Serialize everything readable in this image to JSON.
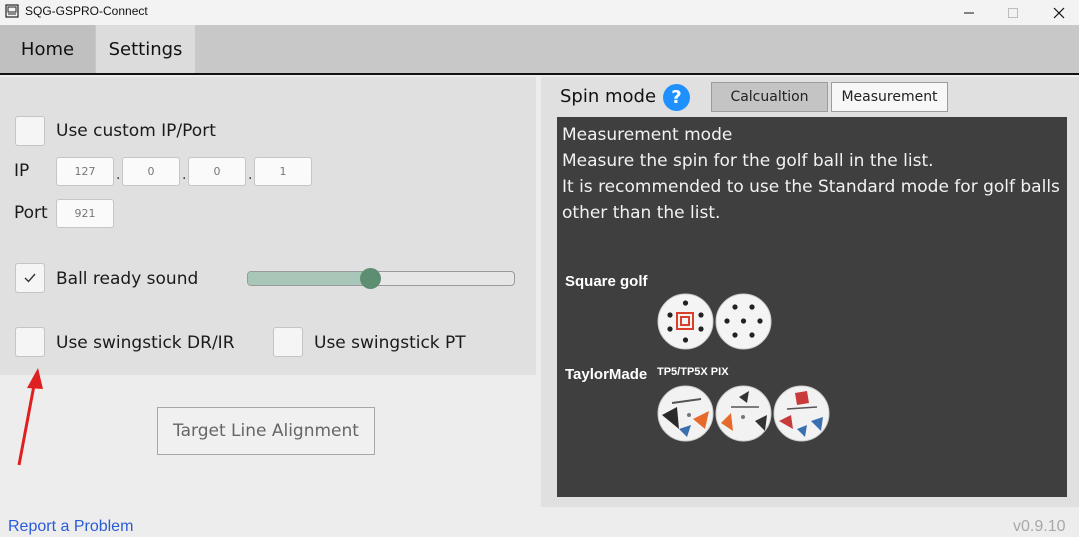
{
  "window": {
    "title": "SQG-GSPRO-Connect",
    "controls": [
      "minimize-icon",
      "maximize-icon",
      "close-icon"
    ]
  },
  "tabs": [
    {
      "label": "Home",
      "active": false
    },
    {
      "label": "Settings",
      "active": true
    }
  ],
  "settings": {
    "custom_ip": {
      "label": "Use custom IP/Port",
      "checked": false
    },
    "ip_label": "IP",
    "ip_octets": [
      "127",
      "0",
      "0",
      "1"
    ],
    "ip_separator": ".",
    "port_label": "Port",
    "port_value": "921",
    "ball_ready_sound": {
      "label": "Ball ready sound",
      "checked": true,
      "volume_fraction": 0.46
    },
    "swingstick_drir": {
      "label": "Use swingstick DR/IR",
      "checked": false
    },
    "swingstick_pt": {
      "label": "Use swingstick PT",
      "checked": false
    },
    "target_button": "Target Line Alignment"
  },
  "spin": {
    "label": "Spin mode",
    "help": "?",
    "modes": [
      {
        "label": "Calcualtion",
        "selected": true
      },
      {
        "label": "Measurement",
        "selected": false
      }
    ],
    "info_lines": [
      "Measurement mode",
      "Measure the spin for the golf ball in the list.",
      "It is recommended to use the Standard mode for golf balls",
      "other than the list."
    ],
    "brands": [
      {
        "name": "Square golf",
        "model": ""
      },
      {
        "name": "TaylorMade",
        "model": "TP5/TP5X PIX"
      }
    ]
  },
  "footer": {
    "report_link": "Report a Problem",
    "version": "v0.9.10"
  },
  "colors": {
    "accent_blue": "#1e90ff",
    "slider_thumb": "#5e8e72",
    "slider_fill": "#a9c7b8",
    "link": "#2a5bd7",
    "annotation_arrow": "#e02020"
  }
}
